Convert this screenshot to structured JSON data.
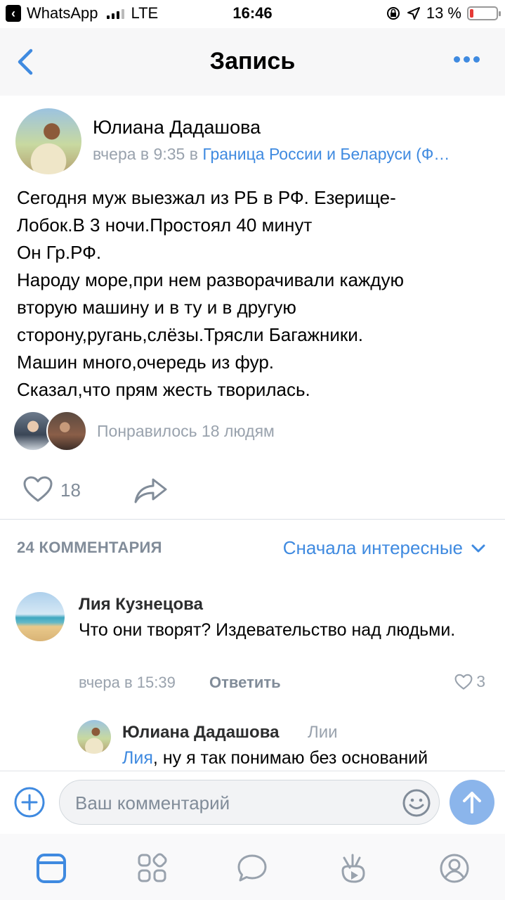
{
  "status_bar": {
    "back_app": "WhatsApp",
    "network": "LTE",
    "time": "16:46",
    "battery": "13 %",
    "battery_level_pct": 13
  },
  "nav": {
    "title": "Запись",
    "back_icon": "chevron-left-icon",
    "more_icon": "more-dots-icon"
  },
  "post": {
    "author": "Юлиана Дадашова",
    "time": "вчера в 9:35",
    "location_prefix": "в",
    "location": "Граница России и Беларуси (Ф…",
    "text": "Сегодня муж выезжал из РБ в РФ. Езерище-\nЛобок.В 3 ночи.Простоял 40 минут\nОн Гр.РФ.\n Народу море,при нем разворачивали каждую\nвторую машину и в ту и в другую\nсторону,ругань,слёзы.Трясли Багажники.\nМашин много,очередь из фур.\nСказал,что прям жесть творилась.",
    "likes_text": "Понравилось 18 людям",
    "like_count": "18"
  },
  "comments": {
    "header": "24 КОММЕНТАРИЯ",
    "sort_label": "Сначала интересные",
    "items": [
      {
        "author": "Лия Кузнецова",
        "text": "Что они творят? Издевательство над людьми.",
        "time": "вчера в 15:39",
        "reply_label": "Ответить",
        "likes": "3"
      }
    ],
    "reply": {
      "author": "Юлиана Дадашова",
      "to": "Лии",
      "mention": "Лия",
      "text": ", ну я так понимаю без оснований"
    }
  },
  "composer": {
    "placeholder": "Ваш комментарий"
  },
  "colors": {
    "accent": "#3f8ae0",
    "secondary_text": "#99a2ad",
    "send_button": "#8bb5eb"
  }
}
